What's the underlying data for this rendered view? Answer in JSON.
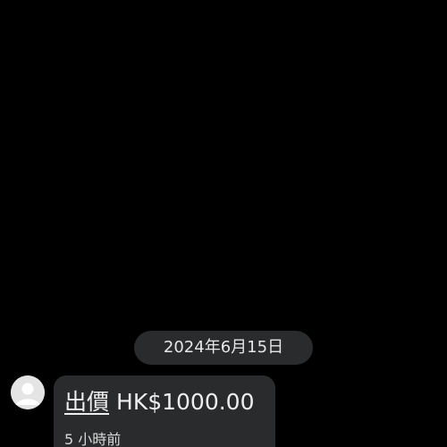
{
  "chat": {
    "date_separator": "2024年6月15日",
    "message": {
      "offer_label": "出價",
      "offer_amount": "HK$1000.00",
      "time_ago": "5 小時前"
    }
  },
  "colors": {
    "background": "#000000",
    "bubble": "#2a2b2d",
    "text": "#eeeeee",
    "avatar": "#e4e4e4"
  },
  "icons": {
    "avatar": "default-user-avatar-icon"
  }
}
